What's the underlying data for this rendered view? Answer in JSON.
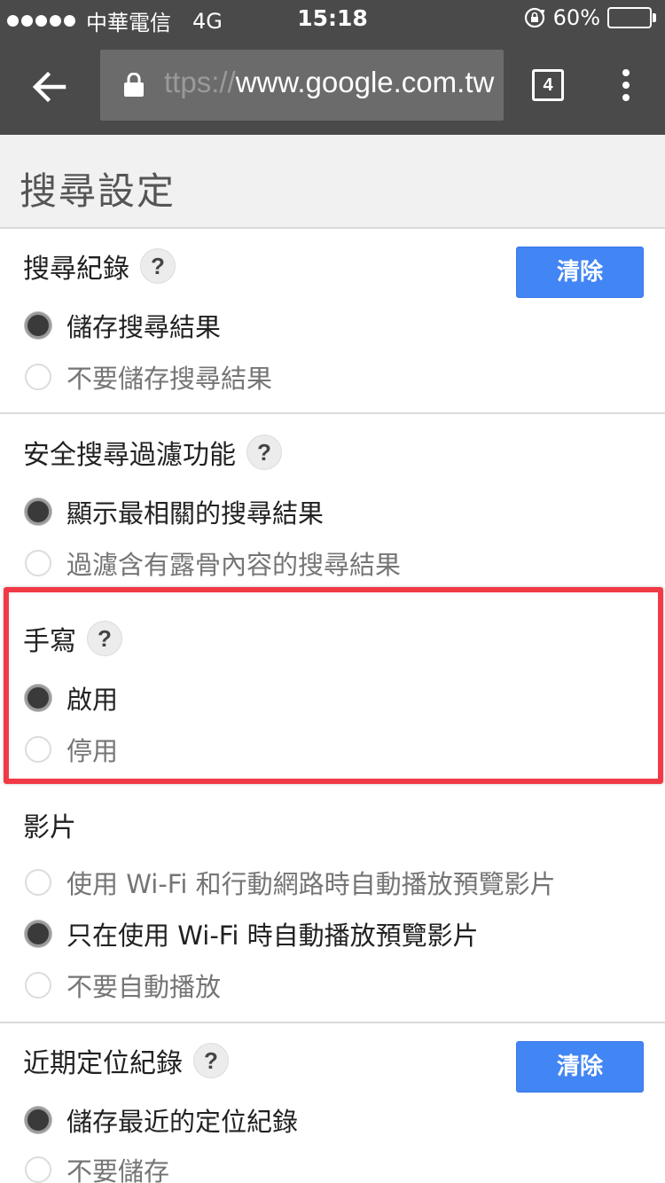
{
  "status_bar": {
    "carrier": "中華電信",
    "network": "4G",
    "time": "15:18",
    "battery_percent": "60%",
    "battery_level": 0.6
  },
  "browser": {
    "url_faded": "ttps://",
    "url_main": "www.google.com.tw",
    "tab_count": "4"
  },
  "page": {
    "title": "搜尋設定"
  },
  "sections": {
    "history": {
      "title": "搜尋紀錄",
      "help": "?",
      "clear_label": "清除",
      "options": [
        "儲存搜尋結果",
        "不要儲存搜尋結果"
      ]
    },
    "safesearch": {
      "title": "安全搜尋過濾功能",
      "help": "?",
      "options": [
        "顯示最相關的搜尋結果",
        "過濾含有露骨內容的搜尋結果"
      ]
    },
    "handwriting": {
      "title": "手寫",
      "help": "?",
      "options": [
        "啟用",
        "停用"
      ]
    },
    "video": {
      "title": "影片",
      "options": [
        "使用 Wi-Fi 和行動網路時自動播放預覽影片",
        "只在使用 Wi-Fi 時自動播放預覽影片",
        "不要自動播放"
      ]
    },
    "location": {
      "title": "近期定位紀錄",
      "help": "?",
      "clear_label": "清除",
      "options": [
        "儲存最近的定位紀錄",
        "不要儲存"
      ]
    }
  },
  "colors": {
    "toolbar": "#4a4a4a",
    "accent_button": "#4285f4",
    "highlight_border": "#f03a46"
  }
}
